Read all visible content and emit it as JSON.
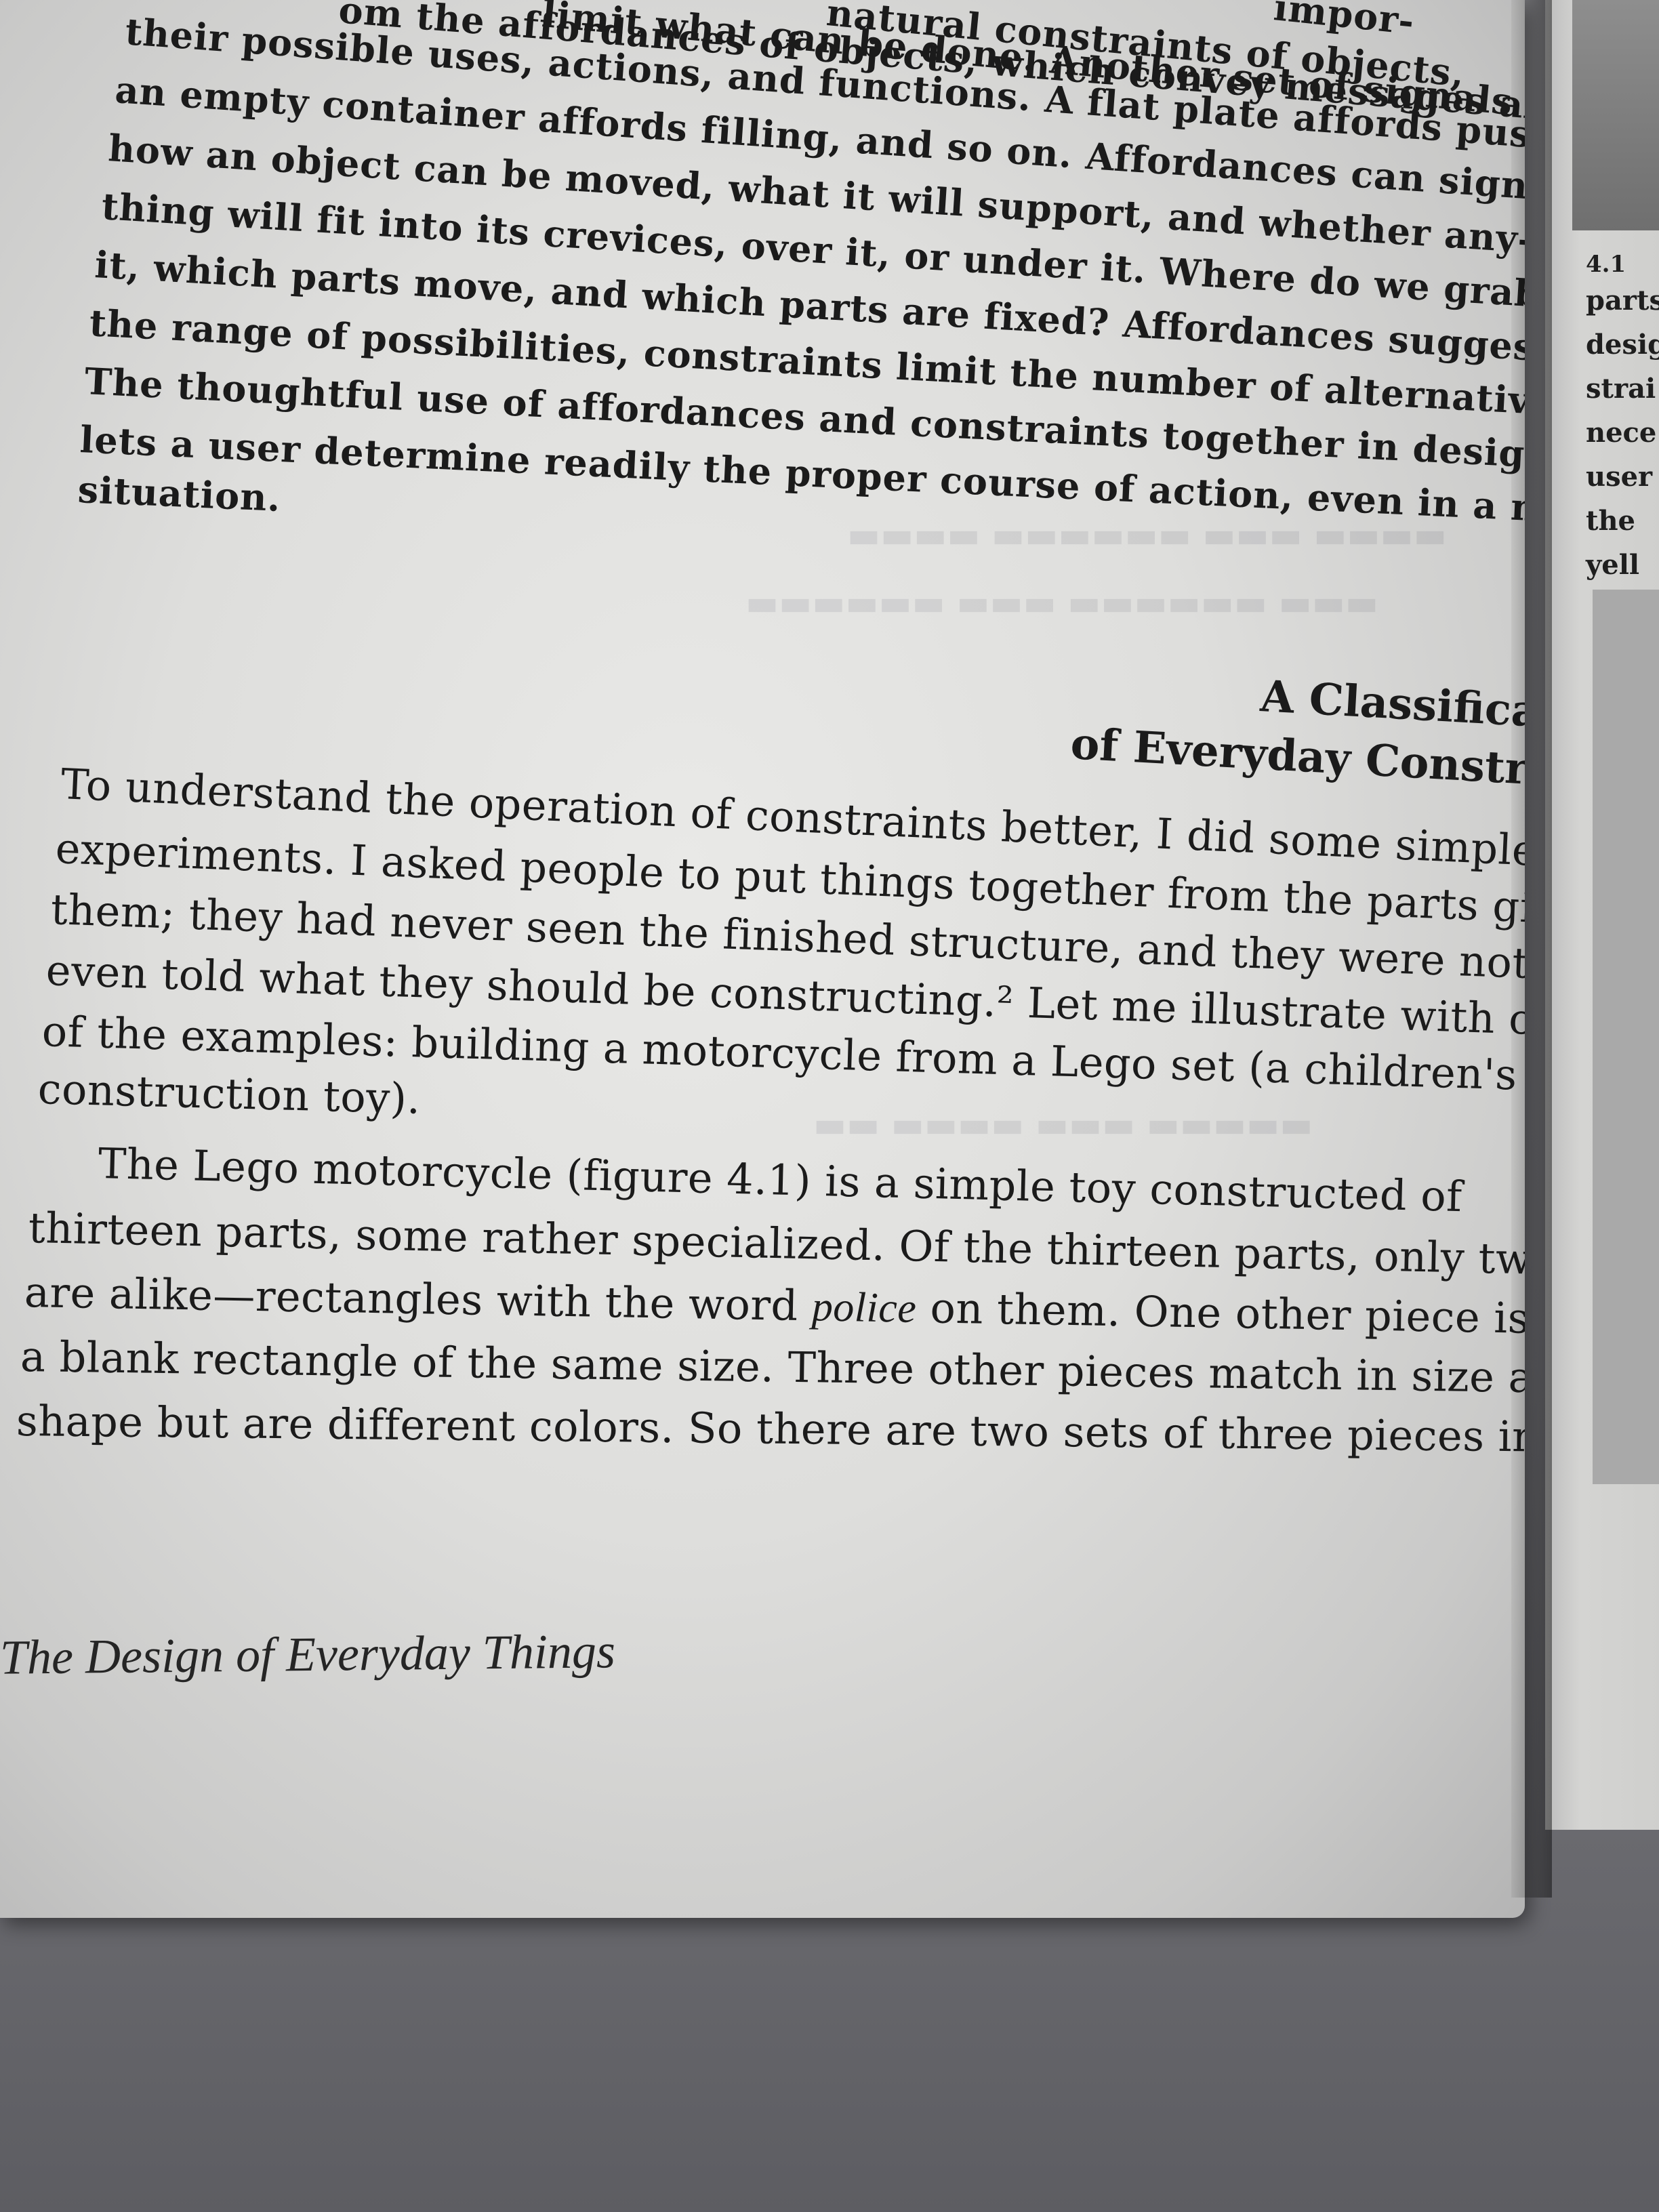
{
  "top_paragraph_lines": [
    "natural constraints of objects,",
    "limit what can be done. Another set of signals",
    "their possible uses, actions, and functions. A flat plate affords pushing,",
    "an empty container affords filling, and so on. Affordances can signal",
    "how an object can be moved, what it will support, and whether any-",
    "thing will fit into its crevices, over it, or under it. Where do we grab",
    "it, which parts move, and which parts are fixed? Affordances suggest",
    "the range of possibilities, constraints limit the number of alternatives.",
    "The thoughtful use of affordances and constraints together in design",
    "lets a user determine readily the proper course of action, even in a novel",
    "situation."
  ],
  "top_fragments": {
    "top_right": "impor-",
    "line2_left": "om the affordances of objects, which convey messages about"
  },
  "section_heading": {
    "line1": "A Classification",
    "line2": "of Everyday Constraints"
  },
  "paragraph1_lines": [
    "To understand the operation of constraints better, I did some simple",
    "experiments. I asked people to put things together from the parts given",
    "them; they had never seen the finished structure, and they were not",
    "even told what they should be constructing.² Let me illustrate with one",
    "of the examples: building a motorcycle from a Lego set (a children's",
    "construction toy)."
  ],
  "paragraph2": {
    "line1": "The Lego motorcycle (figure 4.1) is a simple toy constructed of",
    "line2": "thirteen parts, some rather specialized. Of the thirteen parts, only two",
    "line3_before": "are alike—rectangles with the word ",
    "line3_italic": "police",
    "line3_after": " on them. One other piece is",
    "line4": "a blank rectangle of the same size. Three other pieces match in size and",
    "line5": "shape but are different colors. So there are two sets of three pieces in"
  },
  "footer": {
    "book_title": "The Design of Everyday Things"
  },
  "right_margin_words": [
    "4.1",
    "parts",
    "desig",
    "strai",
    "nece",
    "user",
    "the",
    "yell"
  ]
}
